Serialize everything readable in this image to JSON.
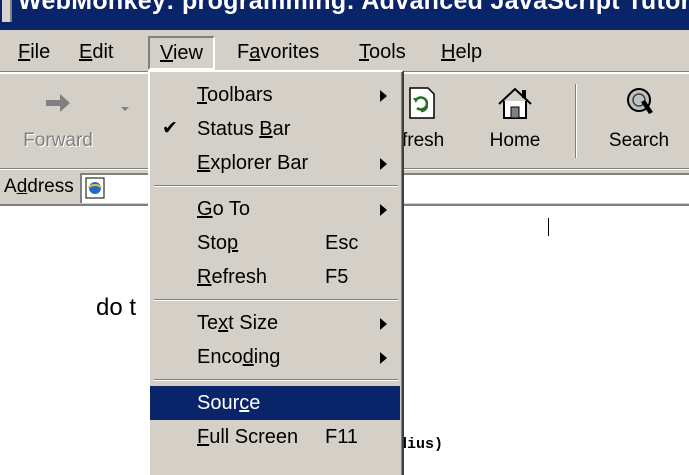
{
  "window": {
    "title": "WebMonkey: programming: Advanced JavaScript Tutorial"
  },
  "menubar": {
    "items": [
      {
        "label": "File",
        "mnemonic": "F"
      },
      {
        "label": "Edit",
        "mnemonic": "E"
      },
      {
        "label": "View",
        "mnemonic": "V"
      },
      {
        "label": "Favorites",
        "mnemonic": "a"
      },
      {
        "label": "Tools",
        "mnemonic": "T"
      },
      {
        "label": "Help",
        "mnemonic": "H"
      }
    ],
    "active": "View"
  },
  "toolbar": {
    "buttons": [
      {
        "label": "Forward",
        "icon": "forward-arrow-icon",
        "enabled": false
      },
      {
        "label": "fresh",
        "icon": "refresh-icon",
        "enabled": true
      },
      {
        "label": "Home",
        "icon": "home-icon",
        "enabled": true
      },
      {
        "label": "Search",
        "icon": "search-icon",
        "enabled": true
      }
    ]
  },
  "address_bar": {
    "label": "Address",
    "mnemonic": "d",
    "icon": "ie-page-icon"
  },
  "content": {
    "text_fragment": "do t",
    "code_fragment": "dius)"
  },
  "view_menu": {
    "items": [
      {
        "label": "Toolbars",
        "mnemonic": "T",
        "shortcut": "",
        "submenu": true,
        "checked": false
      },
      {
        "label": "Status Bar",
        "mnemonic": "B",
        "shortcut": "",
        "submenu": false,
        "checked": true
      },
      {
        "label": "Explorer Bar",
        "mnemonic": "E",
        "shortcut": "",
        "submenu": true,
        "checked": false
      },
      {
        "separator": true
      },
      {
        "label": "Go To",
        "mnemonic": "G",
        "shortcut": "",
        "submenu": true,
        "checked": false
      },
      {
        "label": "Stop",
        "mnemonic": "p",
        "shortcut": "Esc",
        "submenu": false,
        "checked": false
      },
      {
        "label": "Refresh",
        "mnemonic": "R",
        "shortcut": "F5",
        "submenu": false,
        "checked": false
      },
      {
        "separator": true
      },
      {
        "label": "Text Size",
        "mnemonic": "x",
        "shortcut": "",
        "submenu": true,
        "checked": false
      },
      {
        "label": "Encoding",
        "mnemonic": "d",
        "shortcut": "",
        "submenu": true,
        "checked": false
      },
      {
        "separator": true
      },
      {
        "label": "Source",
        "mnemonic": "c",
        "shortcut": "",
        "submenu": false,
        "checked": false,
        "highlighted": true
      },
      {
        "label": "Full Screen",
        "mnemonic": "F",
        "shortcut": "F11",
        "submenu": false,
        "checked": false
      }
    ]
  },
  "colors": {
    "chrome": "#d4d0c8",
    "highlight": "#0a246a",
    "title_bar": "#0a246a"
  }
}
